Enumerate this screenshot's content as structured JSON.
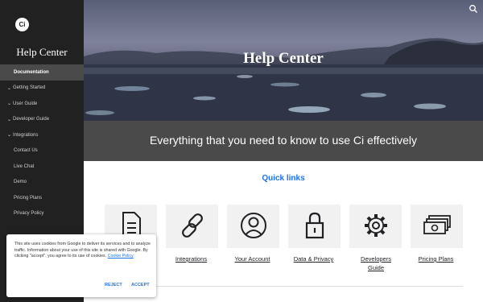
{
  "sidebar": {
    "logo_text": "Ci",
    "title": "Help Center",
    "items": [
      {
        "label": "Documentation"
      },
      {
        "label": "Getting Started",
        "chevron": "chevron-down-icon"
      },
      {
        "label": "User Guide",
        "chevron": "chevron-down-icon"
      },
      {
        "label": "Developer Guide",
        "chevron": "chevron-down-icon"
      },
      {
        "label": "Integrations",
        "chevron": "chevron-down-icon"
      },
      {
        "label": "Contact Us"
      },
      {
        "label": "Live Chat"
      },
      {
        "label": "Demo"
      },
      {
        "label": "Pricing Plans"
      },
      {
        "label": "Privacy Policy"
      }
    ]
  },
  "hero": {
    "title": "Help Center",
    "search_icon": "search-icon"
  },
  "tagline": "Everything that you need to know to use Ci effectively",
  "quick_links": {
    "title": "Quick links",
    "items": [
      {
        "label": "",
        "icon": "document-icon"
      },
      {
        "label": "Integrations",
        "icon": "link-icon"
      },
      {
        "label": "Your Account",
        "icon": "user-account-icon"
      },
      {
        "label": "Data & Privacy",
        "icon": "padlock-icon"
      },
      {
        "label": "Developers Guide",
        "icon": "gear-icon"
      },
      {
        "label": "Pricing Plans",
        "icon": "money-icon"
      }
    ]
  },
  "cookie_banner": {
    "text": "This site uses cookies from Google to deliver its services and to analyze traffic. Information about your use of this site is shared with Google. By clicking \"accept\", you agree to its use of cookies.",
    "link_label": "Cookie Policy",
    "reject_label": "REJECT",
    "accept_label": "ACCEPT"
  },
  "colors": {
    "sidebar_bg": "#212121",
    "accent": "#1a73e8",
    "band_bg": "#4a4a4a"
  }
}
